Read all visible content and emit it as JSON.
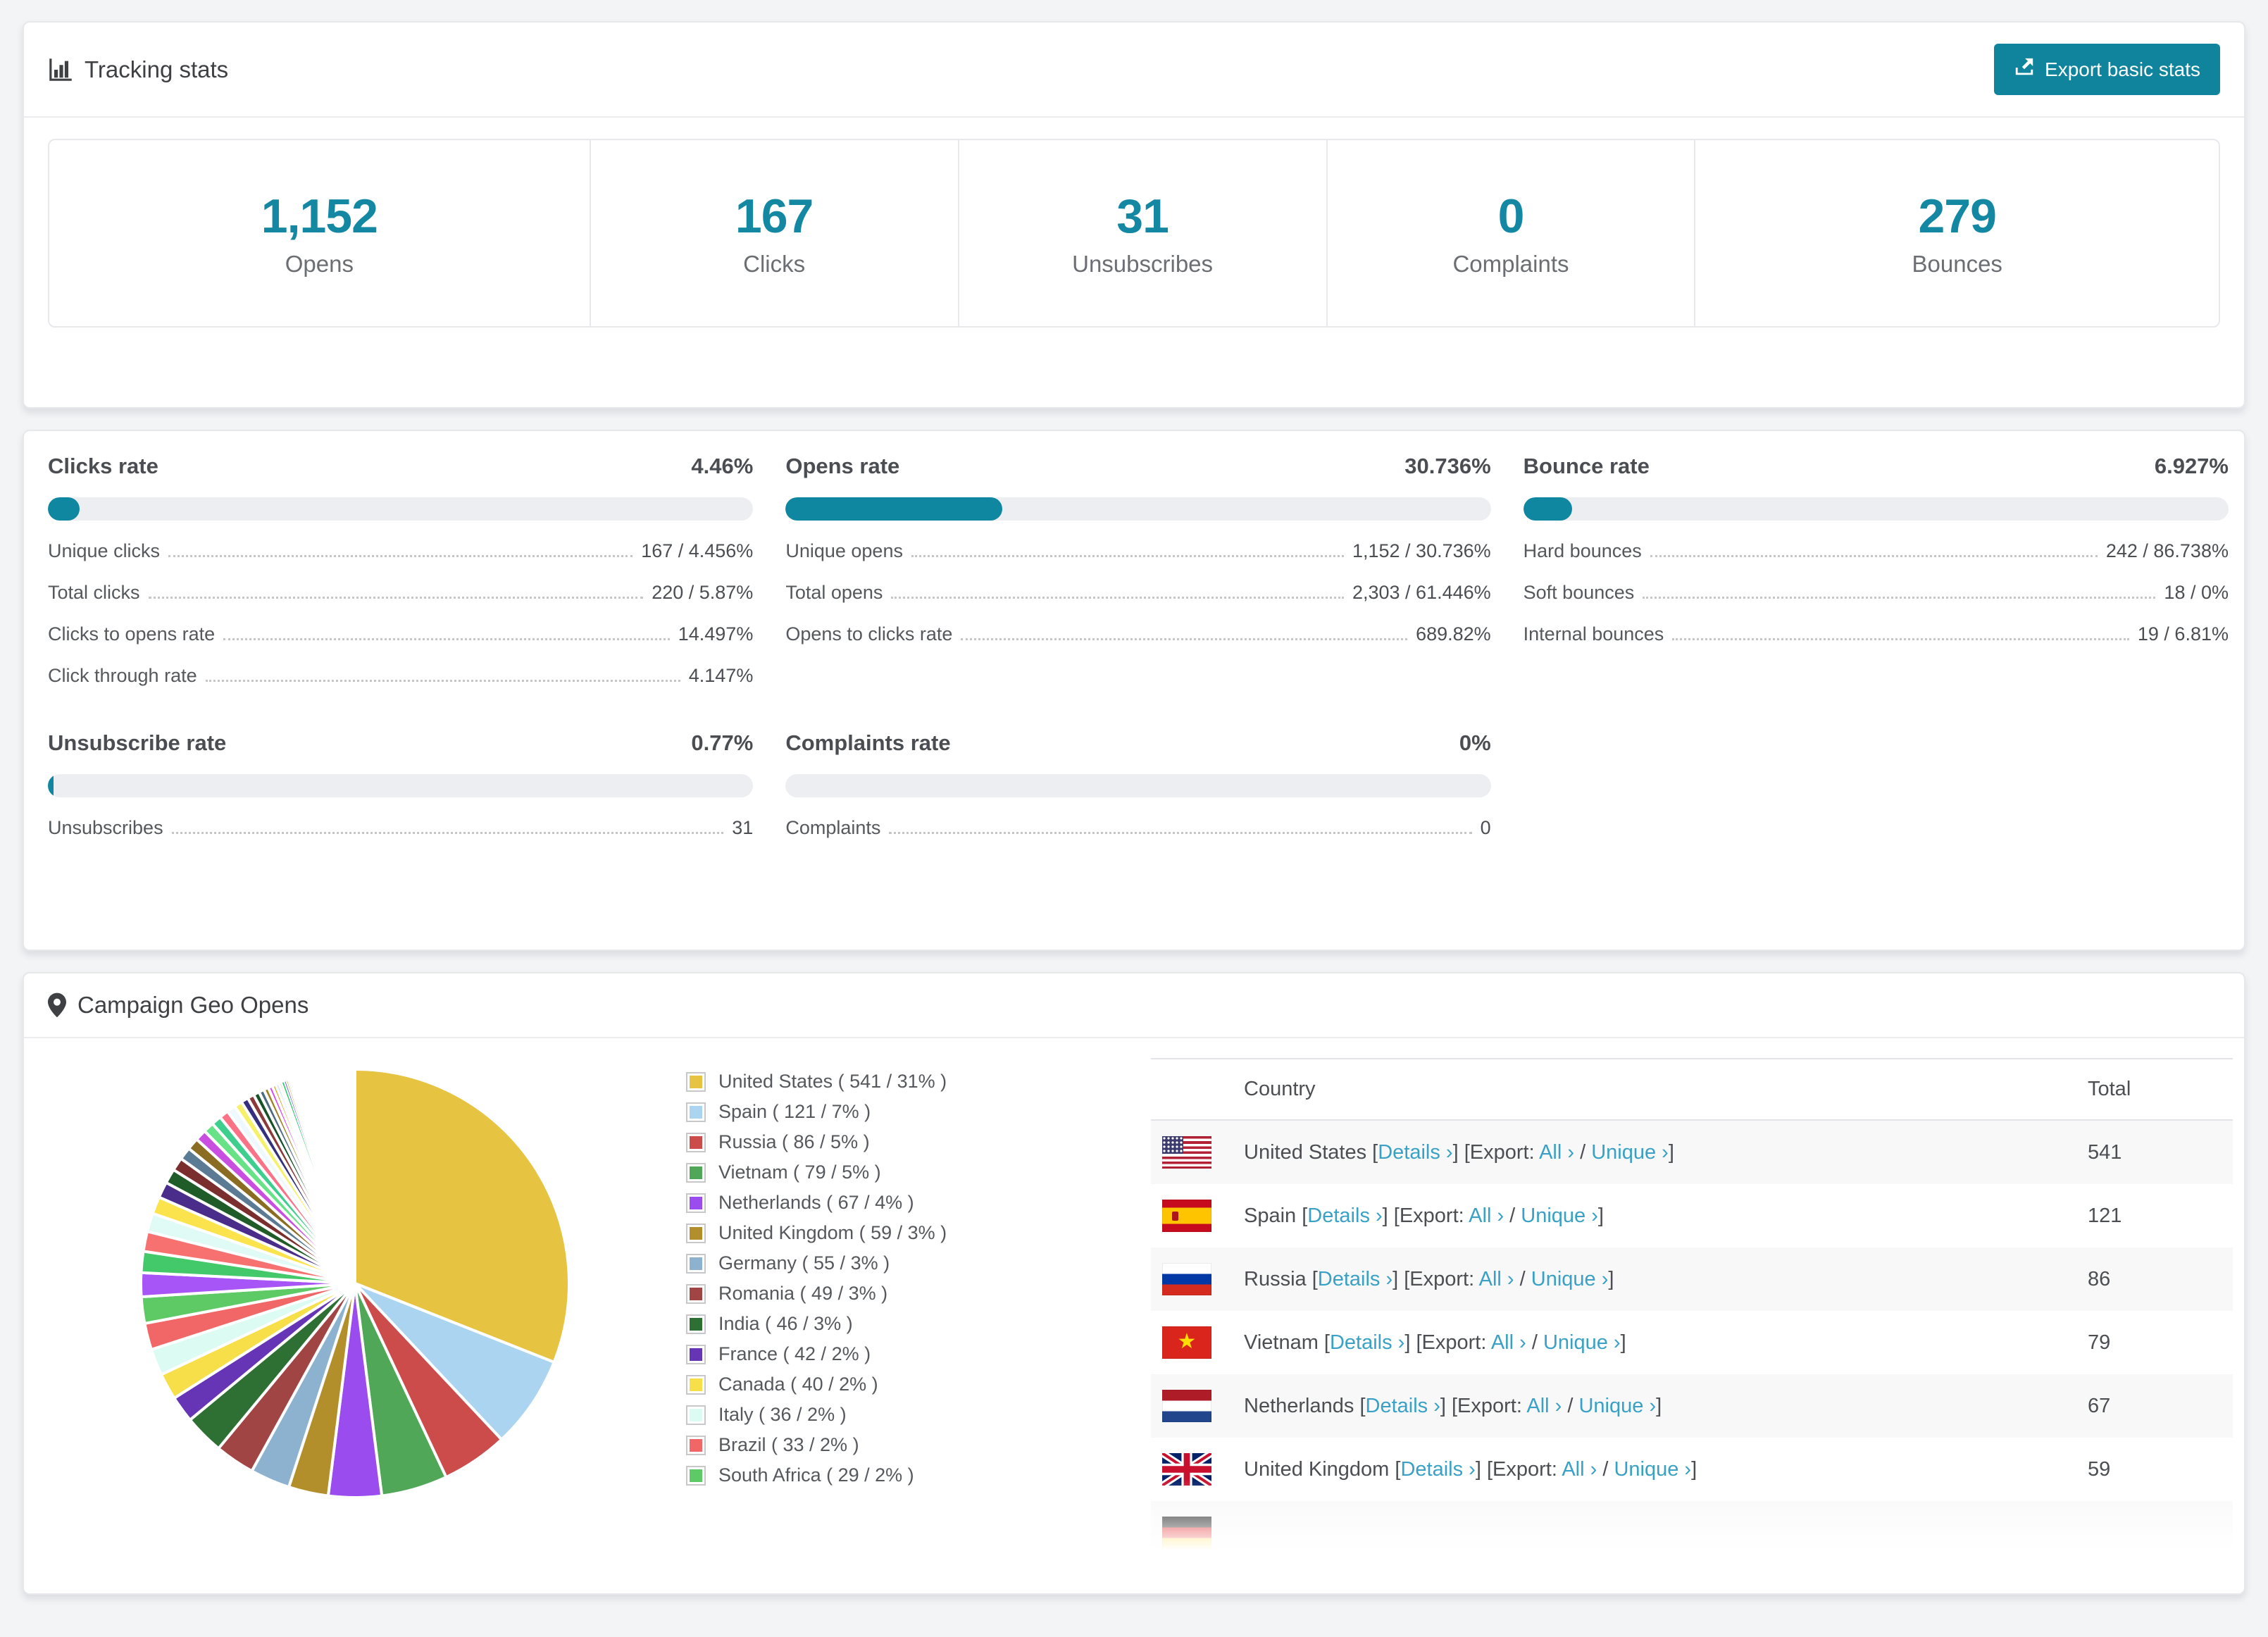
{
  "page": {
    "background": "#f3f4f6",
    "accent": "#1287a0",
    "link_color": "#38a1c5"
  },
  "tracking": {
    "title": "Tracking stats",
    "export_button": "Export basic stats",
    "stats": [
      {
        "value": "1,152",
        "label": "Opens"
      },
      {
        "value": "167",
        "label": "Clicks"
      },
      {
        "value": "31",
        "label": "Unsubscribes"
      },
      {
        "value": "0",
        "label": "Complaints"
      },
      {
        "value": "279",
        "label": "Bounces"
      }
    ]
  },
  "rates_row1": [
    {
      "title": "Clicks rate",
      "value": "4.46%",
      "percent": 4.46,
      "rows": [
        {
          "label": "Unique clicks",
          "value": "167 / 4.456%"
        },
        {
          "label": "Total clicks",
          "value": "220 / 5.87%"
        },
        {
          "label": "Clicks to opens rate",
          "value": "14.497%"
        },
        {
          "label": "Click through rate",
          "value": "4.147%"
        }
      ]
    },
    {
      "title": "Opens rate",
      "value": "30.736%",
      "percent": 30.736,
      "rows": [
        {
          "label": "Unique opens",
          "value": "1,152 / 30.736%"
        },
        {
          "label": "Total opens",
          "value": "2,303 / 61.446%"
        },
        {
          "label": "Opens to clicks rate",
          "value": "689.82%"
        }
      ]
    },
    {
      "title": "Bounce rate",
      "value": "6.927%",
      "percent": 6.927,
      "rows": [
        {
          "label": "Hard bounces",
          "value": "242 / 86.738%"
        },
        {
          "label": "Soft bounces",
          "value": "18 / 0%"
        },
        {
          "label": "Internal bounces",
          "value": "19 / 6.81%"
        }
      ]
    }
  ],
  "rates_row2": [
    {
      "title": "Unsubscribe rate",
      "value": "0.77%",
      "percent": 0.77,
      "rows": [
        {
          "label": "Unsubscribes",
          "value": "31"
        }
      ]
    },
    {
      "title": "Complaints rate",
      "value": "0%",
      "percent": 0,
      "rows": [
        {
          "label": "Complaints",
          "value": "0"
        }
      ]
    }
  ],
  "geo": {
    "title": "Campaign Geo Opens",
    "table": {
      "headers": {
        "country": "Country",
        "total": "Total"
      },
      "links": {
        "details": "Details ›",
        "export_prefix": "Export:",
        "all": "All ›",
        "unique": "Unique ›"
      },
      "rows": [
        {
          "country": "United States",
          "flag": "us",
          "total": "541",
          "partial": false
        },
        {
          "country": "Spain",
          "flag": "es",
          "total": "121",
          "partial": false
        },
        {
          "country": "Russia",
          "flag": "ru",
          "total": "86",
          "partial": false
        },
        {
          "country": "Vietnam",
          "flag": "vn",
          "total": "79",
          "partial": false
        },
        {
          "country": "Netherlands",
          "flag": "nl",
          "total": "67",
          "partial": false
        },
        {
          "country": "United Kingdom",
          "flag": "gb",
          "total": "59",
          "partial": false
        },
        {
          "country": "",
          "flag": "de",
          "total": "",
          "partial": true
        }
      ]
    }
  },
  "chart_data": {
    "type": "pie",
    "title": "Campaign Geo Opens",
    "unit": "opens",
    "legend_position": "right",
    "start_angle": "12 o'clock, clockwise",
    "legend_format": "{label} ( {count} / {pct}% )",
    "slices": [
      {
        "label": "United States",
        "count": 541,
        "pct": 31,
        "color": "#e7c342"
      },
      {
        "label": "Spain",
        "count": 121,
        "pct": 7,
        "color": "#abd4f1"
      },
      {
        "label": "Russia",
        "count": 86,
        "pct": 5,
        "color": "#cc4b4b"
      },
      {
        "label": "Vietnam",
        "count": 79,
        "pct": 5,
        "color": "#4fa757"
      },
      {
        "label": "Netherlands",
        "count": 67,
        "pct": 4,
        "color": "#9b4cee"
      },
      {
        "label": "United Kingdom",
        "count": 59,
        "pct": 3,
        "color": "#b28f2b"
      },
      {
        "label": "Germany",
        "count": 55,
        "pct": 3,
        "color": "#8db2cf"
      },
      {
        "label": "Romania",
        "count": 49,
        "pct": 3,
        "color": "#a04444"
      },
      {
        "label": "India",
        "count": 46,
        "pct": 3,
        "color": "#2e7034"
      },
      {
        "label": "France",
        "count": 42,
        "pct": 2,
        "color": "#6635b5"
      },
      {
        "label": "Canada",
        "count": 40,
        "pct": 2,
        "color": "#f6df49"
      },
      {
        "label": "Italy",
        "count": 36,
        "pct": 2,
        "color": "#dbfbf3"
      },
      {
        "label": "Brazil",
        "count": 33,
        "pct": 2,
        "color": "#f16767"
      },
      {
        "label": "South Africa",
        "count": 29,
        "pct": 2,
        "color": "#5dca65"
      }
    ],
    "other_slices_estimated_pct": [
      1.8,
      1.6,
      1.5,
      1.4,
      1.3,
      1.2,
      1.1,
      1.0,
      0.95,
      0.9,
      0.85,
      0.8,
      0.75,
      0.7,
      0.65,
      0.6,
      0.55,
      0.5,
      0.45,
      0.4,
      0.36,
      0.32,
      0.28,
      0.25,
      0.22,
      0.19,
      0.16,
      0.14,
      0.12,
      0.1,
      0.08,
      0.07,
      0.06,
      0.05
    ],
    "other_slices_colors": [
      "#a855f7",
      "#44c96a",
      "#f87171",
      "#e0fbf6",
      "#fbe34d",
      "#4a2d8a",
      "#1f5c28",
      "#7a2e2e",
      "#5b7a94",
      "#8a6d22",
      "#c94fe0",
      "#67e287",
      "#3ecf8e",
      "#fb7185",
      "#eef9ff",
      "#f7f06a",
      "#34307e",
      "#8b3a3a",
      "#175229",
      "#4d6a80",
      "#9c8021",
      "#d946ef",
      "#d4a017",
      "#93c5fd",
      "#ef4444",
      "#22c55e",
      "#6366f1",
      "#caa02a",
      "#7dd3fc",
      "#f43f5e",
      "#84cc16",
      "#8b5cf6",
      "#e879f9",
      "#b45309"
    ]
  }
}
